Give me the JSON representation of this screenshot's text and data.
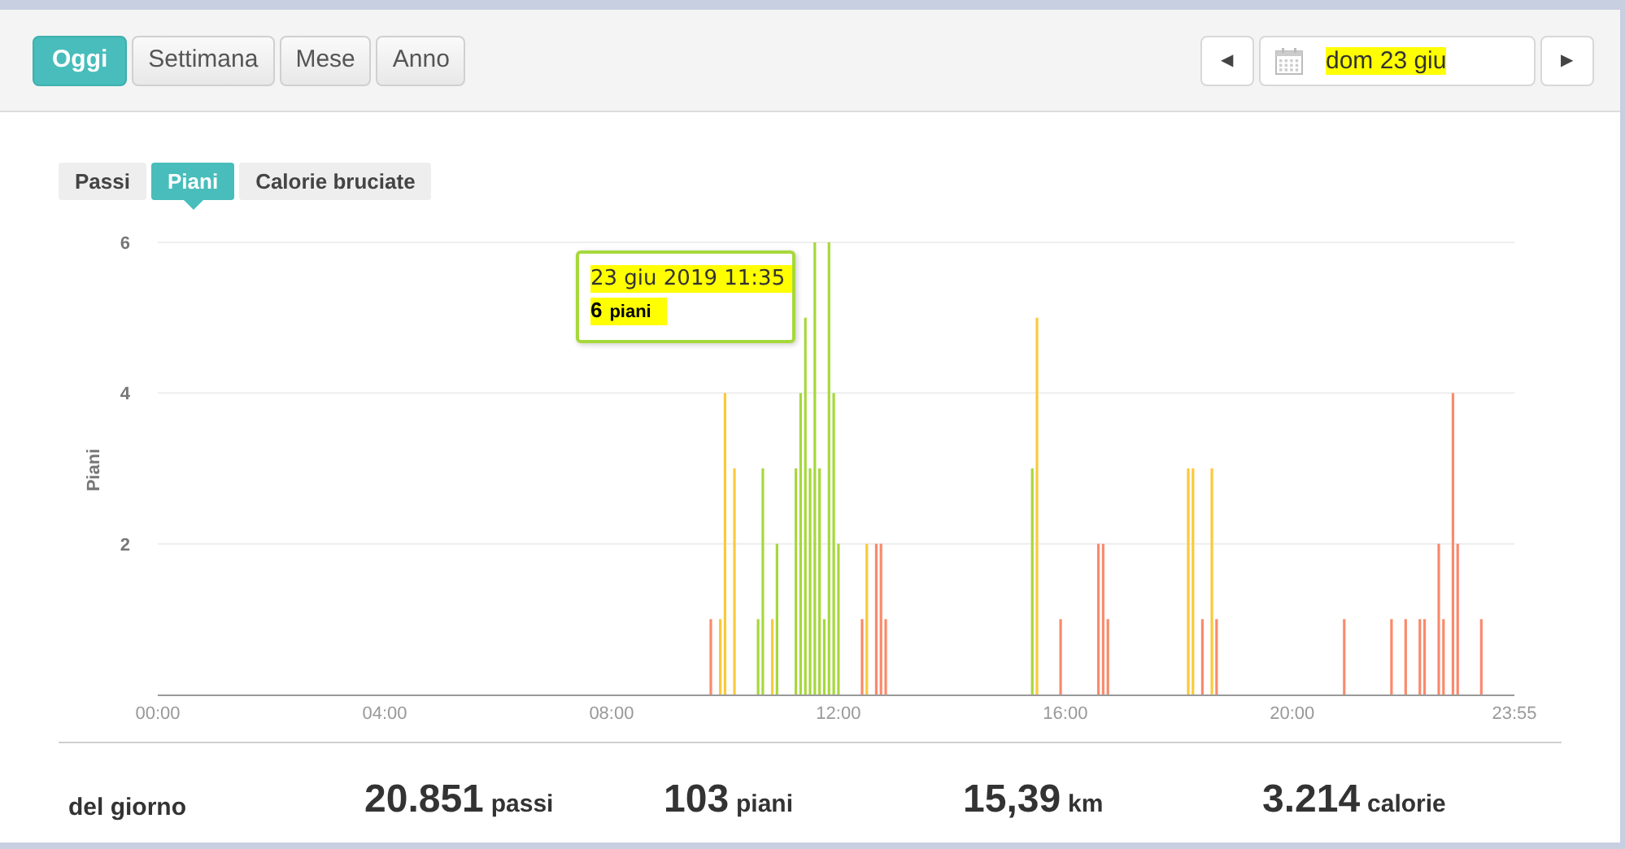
{
  "period_buttons": [
    {
      "label": "Oggi",
      "selected": true
    },
    {
      "label": "Settimana",
      "selected": false
    },
    {
      "label": "Mese",
      "selected": false
    },
    {
      "label": "Anno",
      "selected": false
    }
  ],
  "date_nav": {
    "prev": "◀",
    "date": "dom 23 giu",
    "next": "▶"
  },
  "metric_tabs": [
    {
      "label": "Passi",
      "selected": false
    },
    {
      "label": "Piani",
      "selected": true
    },
    {
      "label": "Calorie bruciate",
      "selected": false
    }
  ],
  "chart": {
    "tooltip": {
      "title": "23 giu 2019 11:35",
      "value": "6",
      "unit": "piani"
    },
    "chart_data": {
      "type": "bar",
      "ylabel": "Piani",
      "xlim": [
        0,
        1435
      ],
      "ylim": [
        0,
        6
      ],
      "xticks": [
        {
          "value": 0,
          "label": "00:00"
        },
        {
          "value": 240,
          "label": "04:00"
        },
        {
          "value": 480,
          "label": "08:00"
        },
        {
          "value": 720,
          "label": "12:00"
        },
        {
          "value": 960,
          "label": "16:00"
        },
        {
          "value": 1200,
          "label": "20:00"
        },
        {
          "value": 1435,
          "label": "23:55"
        }
      ],
      "yticks": [
        2,
        4,
        6
      ],
      "x": [
        585,
        595,
        600,
        610,
        635,
        640,
        650,
        655,
        675,
        680,
        685,
        690,
        695,
        700,
        705,
        710,
        715,
        720,
        745,
        750,
        760,
        765,
        770,
        925,
        930,
        955,
        995,
        1000,
        1005,
        1090,
        1095,
        1105,
        1115,
        1120,
        1255,
        1305,
        1320,
        1335,
        1340,
        1355,
        1360,
        1370,
        1375,
        1400
      ],
      "series": [
        {
          "color": "#fa8a6c",
          "values": [
            1,
            null,
            null,
            null,
            null,
            null,
            null,
            null,
            null,
            null,
            null,
            null,
            null,
            null,
            null,
            null,
            null,
            null,
            1,
            null,
            2,
            2,
            1,
            null,
            null,
            1,
            2,
            2,
            1,
            null,
            null,
            1,
            null,
            1,
            1,
            1,
            1,
            1,
            1,
            2,
            1,
            4,
            2,
            1
          ]
        },
        {
          "color": "#fbc93a",
          "values": [
            null,
            1,
            4,
            3,
            null,
            null,
            1,
            null,
            null,
            null,
            null,
            null,
            null,
            null,
            null,
            null,
            null,
            null,
            null,
            2,
            null,
            null,
            null,
            null,
            5,
            null,
            null,
            null,
            null,
            3,
            3,
            null,
            3,
            null,
            null,
            null,
            null,
            null,
            null,
            null,
            null,
            null,
            null,
            null
          ]
        },
        {
          "color": "#a6d83c",
          "values": [
            null,
            null,
            null,
            null,
            1,
            3,
            null,
            2,
            3,
            4,
            5,
            3,
            6,
            3,
            1,
            6,
            4,
            2,
            null,
            null,
            null,
            null,
            null,
            3,
            null,
            null,
            null,
            null,
            null,
            null,
            null,
            null,
            null,
            null,
            null,
            null,
            null,
            null,
            null,
            null,
            null,
            null,
            null,
            null
          ]
        }
      ]
    }
  },
  "summary": {
    "label": "del giorno",
    "items": [
      {
        "value": "20.851",
        "unit": "passi"
      },
      {
        "value": "103",
        "unit": "piani"
      },
      {
        "value": "15,39",
        "unit": "km"
      },
      {
        "value": "3.214",
        "unit": "calorie"
      }
    ]
  }
}
